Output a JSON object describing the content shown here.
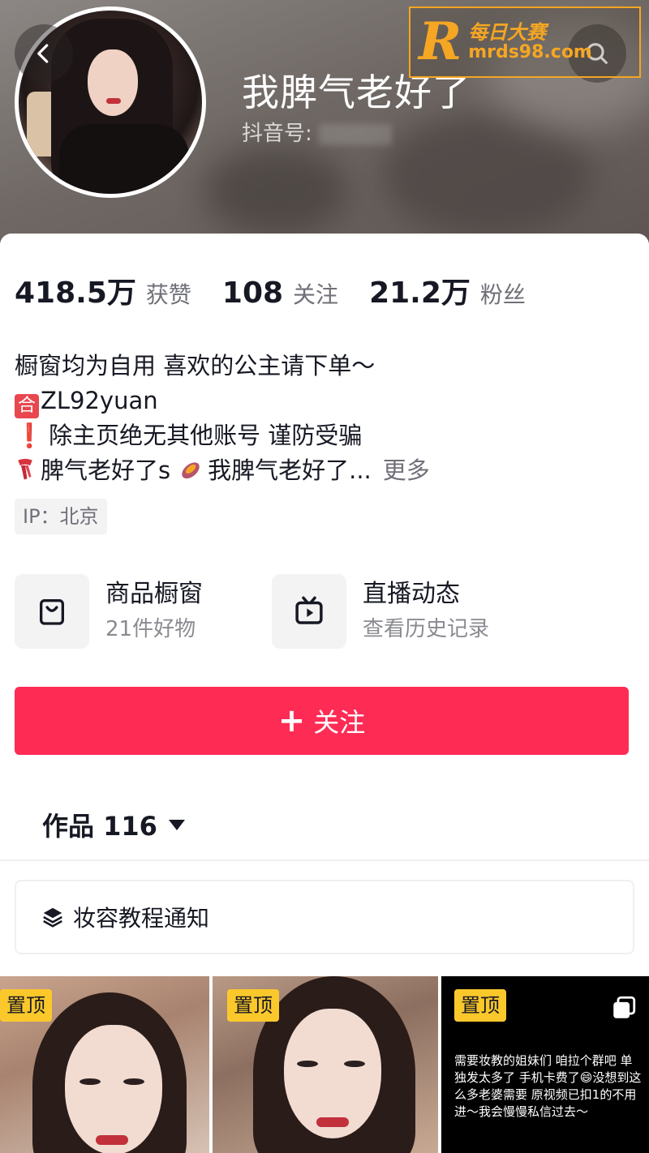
{
  "header": {
    "nickname": "我脾气老好了",
    "douyin_id_label": "抖音号:"
  },
  "watermark": {
    "logo_letter": "R",
    "text_cn": "每日大赛",
    "url": "mrds98.com"
  },
  "stats": [
    {
      "value": "418.5万",
      "label": "获赞"
    },
    {
      "value": "108",
      "label": "关注"
    },
    {
      "value": "21.2万",
      "label": "粉丝"
    }
  ],
  "bio": {
    "line1": "橱窗均为自用 喜欢的公主请下单～",
    "line2_badge": "合",
    "line2": "ZL92yuan",
    "line3_mark": "❗",
    "line3": "除主页绝无其他账号 谨防受骗",
    "line4_a": "脾气老好了s",
    "line4_b": "我脾气老好了...",
    "more": "更多"
  },
  "ip_tag": "IP：北京",
  "shortcuts": [
    {
      "title": "商品橱窗",
      "subtitle": "21件好物",
      "icon": "shopping-bag-icon"
    },
    {
      "title": "直播动态",
      "subtitle": "查看历史记录",
      "icon": "tv-icon"
    }
  ],
  "follow_button": {
    "plus": "+",
    "label": "关注"
  },
  "works_tab": {
    "label": "作品 116"
  },
  "collection": {
    "label": "妆容教程通知",
    "icon": "layers-icon"
  },
  "grid": {
    "pin_label": "置顶",
    "cell3_text": "需要妆教的姐妹们 咱拉个群吧  单独发太多了 手机卡费了😄没想到这么多老婆需要 原视频已扣1的不用进～我会慢慢私信过去～"
  },
  "colors": {
    "accent": "#fe2c55",
    "pin": "#fbc82c",
    "watermark": "#f5a623"
  }
}
